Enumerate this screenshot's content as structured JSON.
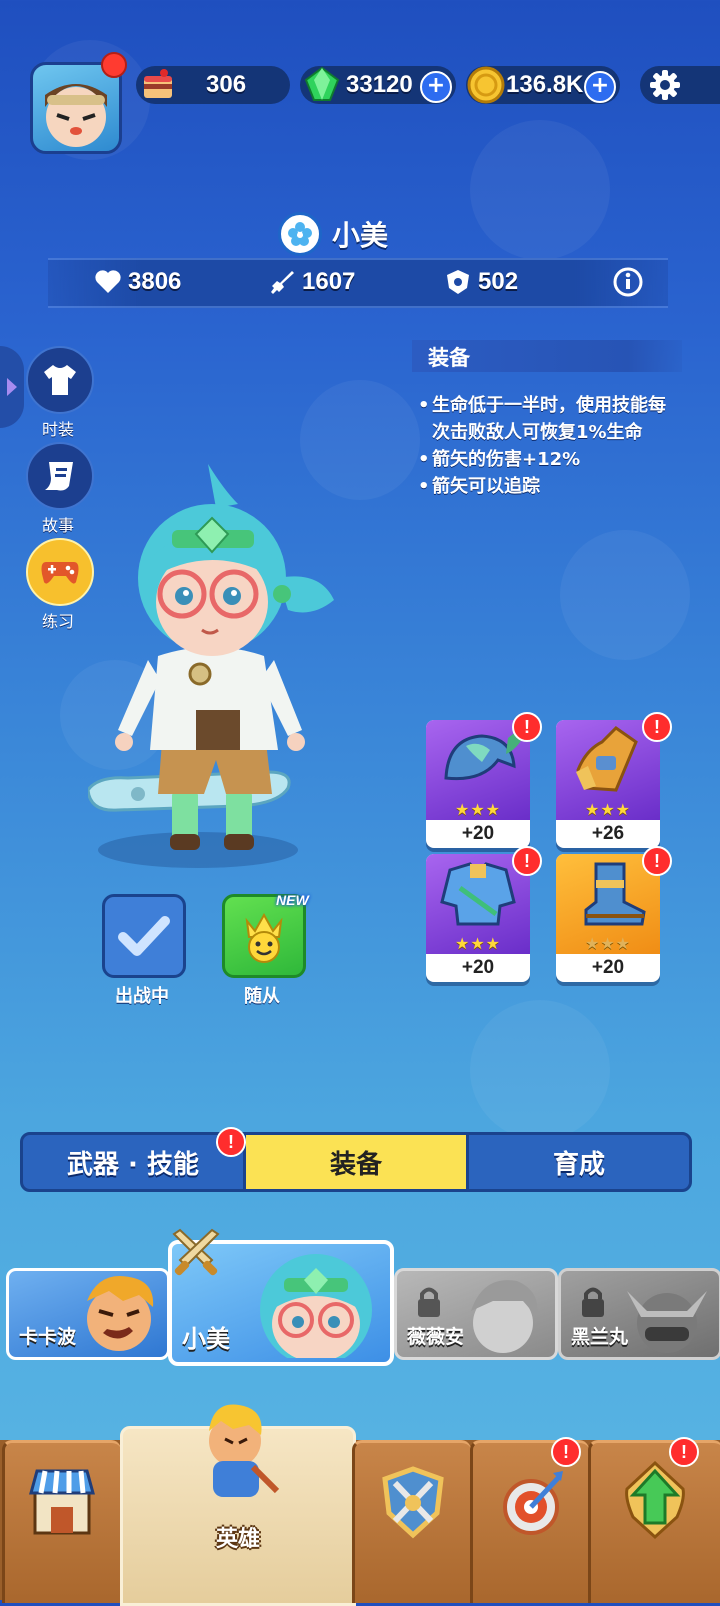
{
  "header": {
    "cake_count": "306",
    "gem_count": "33120",
    "coin_count": "136.8K",
    "plus_symbol": "+"
  },
  "hero": {
    "name": "小美",
    "health": "3806",
    "attack": "1607",
    "defense": "502"
  },
  "side_menu": {
    "costume": "时装",
    "story": "故事",
    "practice": "练习"
  },
  "equipment_desc": {
    "title": "装备",
    "effects": [
      "生命低于一半时，使用技能每次击败敌人可恢复1%生命",
      "箭矢的伤害+12%",
      "箭矢可以追踪"
    ]
  },
  "equipment_slots": [
    {
      "name": "helmet",
      "level": "+20",
      "stars": 3,
      "bg": "purple"
    },
    {
      "name": "gauntlet",
      "level": "+26",
      "stars": 3,
      "bg": "purple"
    },
    {
      "name": "armor",
      "level": "+20",
      "stars": 3,
      "bg": "purple"
    },
    {
      "name": "boots",
      "level": "+20",
      "stars": 3,
      "bg": "orange"
    }
  ],
  "alert_mark": "!",
  "actions": {
    "deployed_label": "出战中",
    "follower_label": "随从",
    "new_badge": "NEW"
  },
  "tabs": [
    {
      "label": "武器 · 技能",
      "active": false
    },
    {
      "label": "装备",
      "active": true
    },
    {
      "label": "育成",
      "active": false
    }
  ],
  "roster": [
    {
      "name": "卡卡波",
      "locked": false
    },
    {
      "name": "小美",
      "locked": false,
      "selected": true
    },
    {
      "name": "薇薇安",
      "locked": true
    },
    {
      "name": "黑兰丸",
      "locked": true
    }
  ],
  "bottom_nav": {
    "hero_label": "英雄"
  },
  "colors": {
    "accent_yellow": "#fbe254",
    "alert_red": "#ff2d2d",
    "panel_blue": "#143577"
  }
}
